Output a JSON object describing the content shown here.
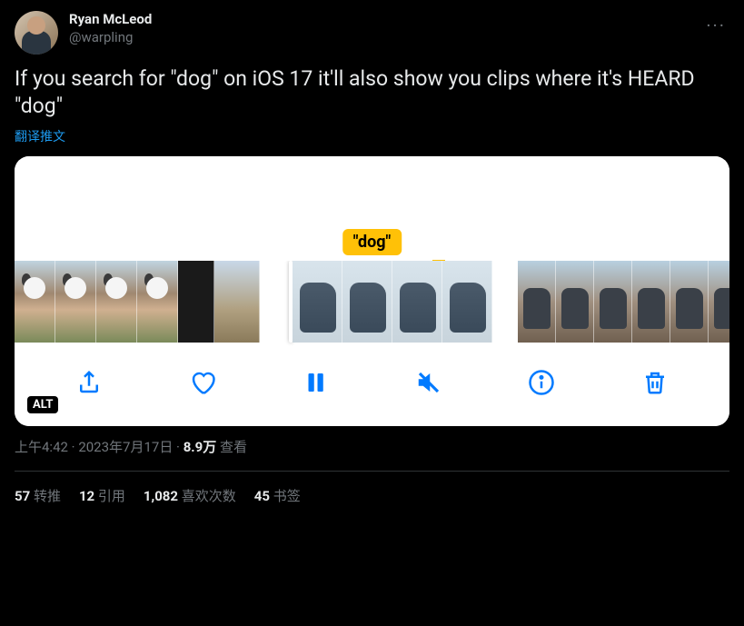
{
  "user": {
    "display_name": "Ryan McLeod",
    "handle": "@warpling"
  },
  "more_glyph": "···",
  "tweet_text": "If you search for \"dog\" on iOS 17 it'll also show you clips where it's HEARD \"dog\"",
  "translate_label": "翻译推文",
  "media": {
    "search_tag": "\"dog\"",
    "alt_badge": "ALT"
  },
  "meta": {
    "time": "上午4:42",
    "sep": " · ",
    "date": "2023年7月17日",
    "views_count": "8.9万",
    "views_label": " 查看"
  },
  "stats": {
    "retweets": {
      "count": "57",
      "label": " 转推"
    },
    "quotes": {
      "count": "12",
      "label": " 引用"
    },
    "likes": {
      "count": "1,082",
      "label": " 喜欢次数"
    },
    "bookmarks": {
      "count": "45",
      "label": " 书签"
    }
  }
}
